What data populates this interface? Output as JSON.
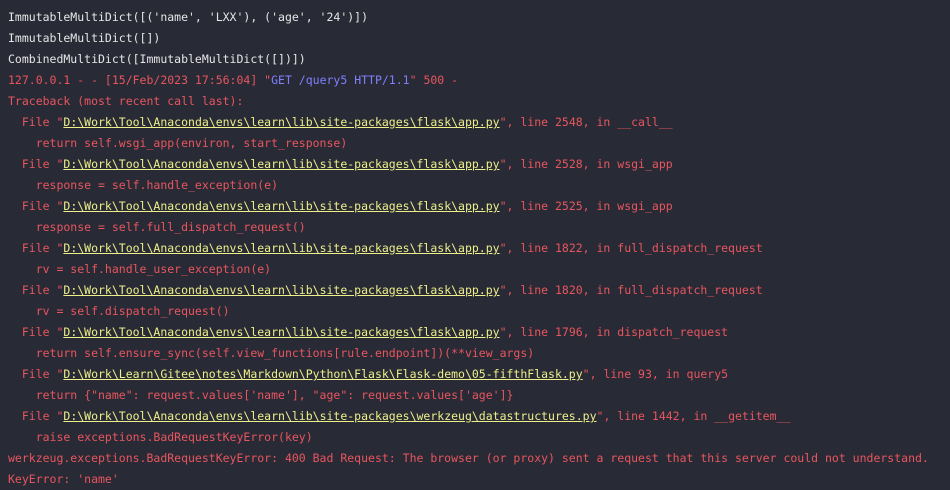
{
  "colors": {
    "background": "#282a36",
    "text": "#e6e6e6",
    "error": "#e8565e",
    "request": "#8080ff",
    "link": "#eef08a"
  },
  "lines": [
    [
      {
        "t": "w",
        "s": "ImmutableMultiDict([('name', 'LXX'), ('age', '24')])"
      }
    ],
    [
      {
        "t": "w",
        "s": "ImmutableMultiDict([])"
      }
    ],
    [
      {
        "t": "w",
        "s": "CombinedMultiDict([ImmutableMultiDict([])])"
      }
    ],
    [
      {
        "t": "r",
        "s": "127.0.0.1 - - [15/Feb/2023 17:56:04] \""
      },
      {
        "t": "b",
        "s": "GET /query5 HTTP/1.1"
      },
      {
        "t": "r",
        "s": "\" 500 -"
      }
    ],
    [
      {
        "t": "r",
        "s": "Traceback (most recent call last):"
      }
    ],
    [
      {
        "t": "r",
        "s": "  File \""
      },
      {
        "t": "y",
        "s": "D:\\Work\\Tool\\Anaconda\\envs\\learn\\lib\\site-packages\\flask\\app.py"
      },
      {
        "t": "r",
        "s": "\", line 2548, in __call__"
      }
    ],
    [
      {
        "t": "r",
        "s": "    return self.wsgi_app(environ, start_response)"
      }
    ],
    [
      {
        "t": "r",
        "s": "  File \""
      },
      {
        "t": "y",
        "s": "D:\\Work\\Tool\\Anaconda\\envs\\learn\\lib\\site-packages\\flask\\app.py"
      },
      {
        "t": "r",
        "s": "\", line 2528, in wsgi_app"
      }
    ],
    [
      {
        "t": "r",
        "s": "    response = self.handle_exception(e)"
      }
    ],
    [
      {
        "t": "r",
        "s": "  File \""
      },
      {
        "t": "y",
        "s": "D:\\Work\\Tool\\Anaconda\\envs\\learn\\lib\\site-packages\\flask\\app.py"
      },
      {
        "t": "r",
        "s": "\", line 2525, in wsgi_app"
      }
    ],
    [
      {
        "t": "r",
        "s": "    response = self.full_dispatch_request()"
      }
    ],
    [
      {
        "t": "r",
        "s": "  File \""
      },
      {
        "t": "y",
        "s": "D:\\Work\\Tool\\Anaconda\\envs\\learn\\lib\\site-packages\\flask\\app.py"
      },
      {
        "t": "r",
        "s": "\", line 1822, in full_dispatch_request"
      }
    ],
    [
      {
        "t": "r",
        "s": "    rv = self.handle_user_exception(e)"
      }
    ],
    [
      {
        "t": "r",
        "s": "  File \""
      },
      {
        "t": "y",
        "s": "D:\\Work\\Tool\\Anaconda\\envs\\learn\\lib\\site-packages\\flask\\app.py"
      },
      {
        "t": "r",
        "s": "\", line 1820, in full_dispatch_request"
      }
    ],
    [
      {
        "t": "r",
        "s": "    rv = self.dispatch_request()"
      }
    ],
    [
      {
        "t": "r",
        "s": "  File \""
      },
      {
        "t": "y",
        "s": "D:\\Work\\Tool\\Anaconda\\envs\\learn\\lib\\site-packages\\flask\\app.py"
      },
      {
        "t": "r",
        "s": "\", line 1796, in dispatch_request"
      }
    ],
    [
      {
        "t": "r",
        "s": "    return self.ensure_sync(self.view_functions[rule.endpoint])(**view_args)"
      }
    ],
    [
      {
        "t": "r",
        "s": "  File \""
      },
      {
        "t": "y",
        "s": "D:\\Work\\Learn\\Gitee\\notes\\Markdown\\Python\\Flask\\Flask-demo\\05-fifthFlask.py"
      },
      {
        "t": "r",
        "s": "\", line 93, in query5"
      }
    ],
    [
      {
        "t": "r",
        "s": "    return {\"name\": request.values['name'], \"age\": request.values['age']}"
      }
    ],
    [
      {
        "t": "r",
        "s": "  File \""
      },
      {
        "t": "y",
        "s": "D:\\Work\\Tool\\Anaconda\\envs\\learn\\lib\\site-packages\\werkzeug\\datastructures.py"
      },
      {
        "t": "r",
        "s": "\", line 1442, in __getitem__"
      }
    ],
    [
      {
        "t": "r",
        "s": "    raise exceptions.BadRequestKeyError(key)"
      }
    ],
    [
      {
        "t": "r",
        "s": "werkzeug.exceptions.BadRequestKeyError: 400 Bad Request: The browser (or proxy) sent a request that this server could not understand."
      }
    ],
    [
      {
        "t": "r",
        "s": "KeyError: 'name'"
      }
    ]
  ]
}
